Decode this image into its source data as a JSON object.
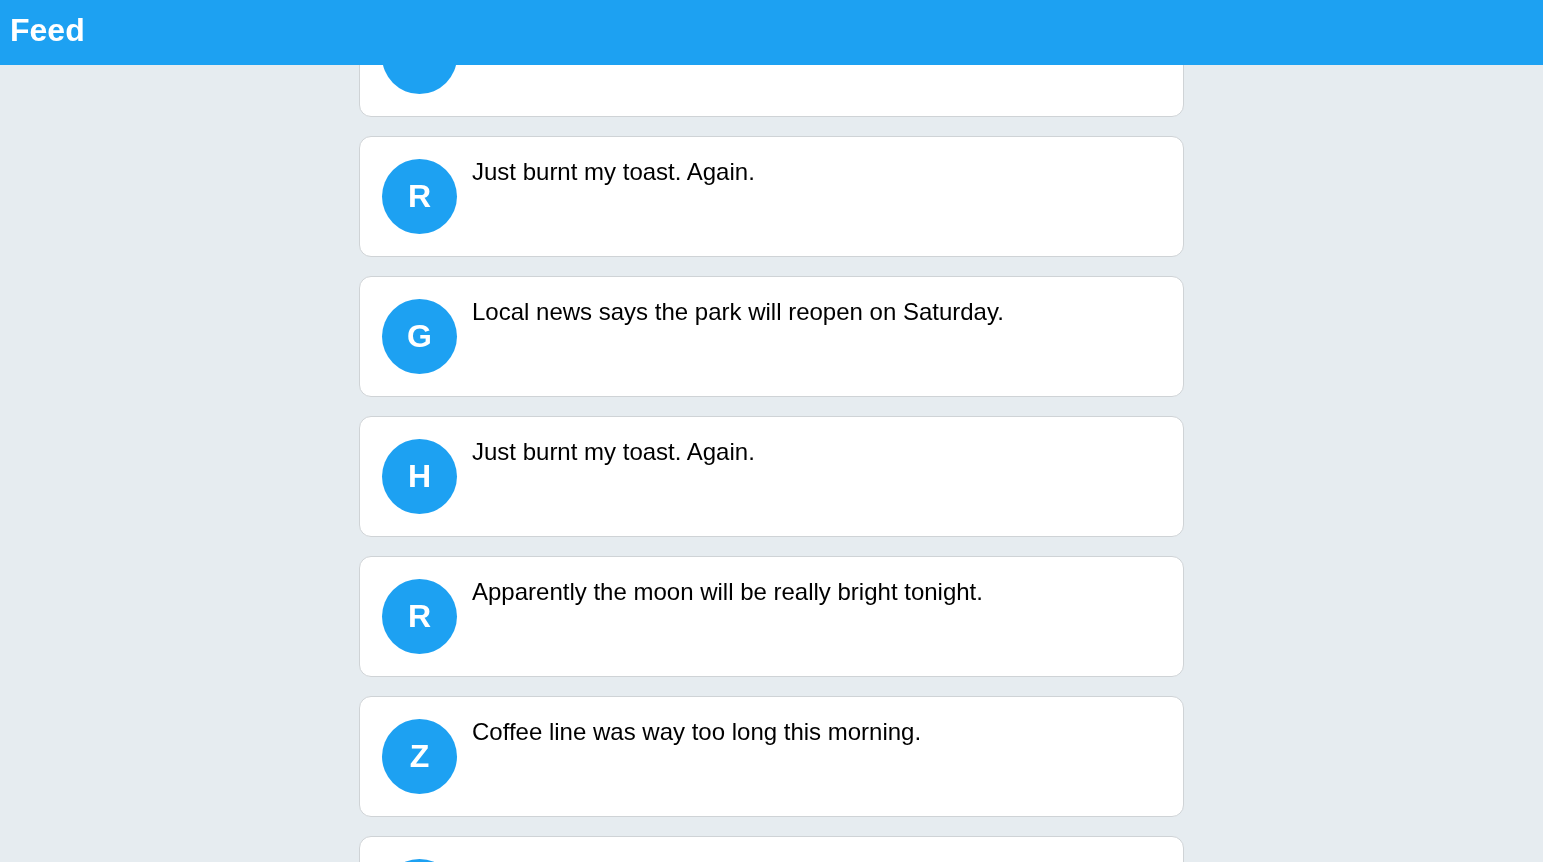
{
  "header": {
    "title": "Feed"
  },
  "posts": [
    {
      "kind": "partial"
    },
    {
      "kind": "post",
      "initial": "R",
      "text": "Just burnt my toast. Again."
    },
    {
      "kind": "post",
      "initial": "G",
      "text": "Local news says the park will reopen on Saturday."
    },
    {
      "kind": "post",
      "initial": "H",
      "text": "Just burnt my toast. Again."
    },
    {
      "kind": "post",
      "initial": "R",
      "text": "Apparently the moon will be really bright tonight."
    },
    {
      "kind": "post",
      "initial": "Z",
      "text": "Coffee line was way too long this morning."
    },
    {
      "kind": "partial"
    }
  ]
}
